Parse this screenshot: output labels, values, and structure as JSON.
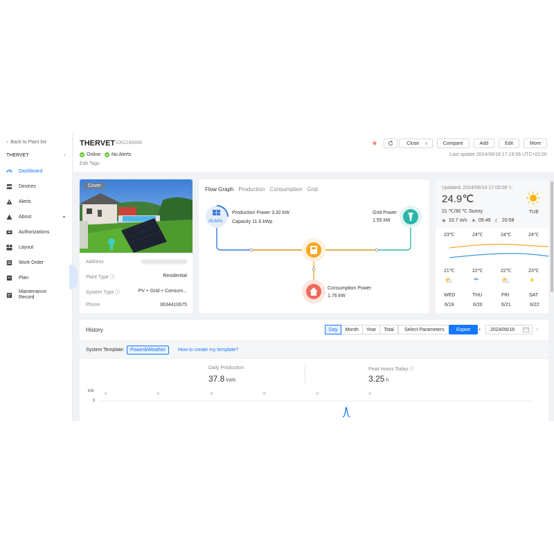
{
  "sidebar": {
    "back_label": "Back to Plant list",
    "plant_name": "THERVET",
    "items": [
      {
        "label": "Dashboard",
        "active": true
      },
      {
        "label": "Devices"
      },
      {
        "label": "Alerts"
      },
      {
        "label": "About"
      },
      {
        "label": "Authorizations"
      },
      {
        "label": "Layout"
      },
      {
        "label": "Work Order"
      },
      {
        "label": "Plan"
      },
      {
        "label": "Maintenance Record"
      }
    ]
  },
  "header": {
    "title": "THERVET",
    "plant_id": "ID62188888",
    "status_online": "Online",
    "status_alerts": "No Alerts",
    "edit_tags": "Edit Tags",
    "close_label": "Close",
    "compare_label": "Compare",
    "add_label": "Add",
    "edit_label": "Edit",
    "more_label": "More",
    "last_update": "Last update 2024/06/18 17:19:56 UTC+02:00"
  },
  "plant_info": {
    "cover_label": "Cover",
    "rows": [
      {
        "key": "Address",
        "value": ""
      },
      {
        "key": "Plant Type",
        "value": "Residential"
      },
      {
        "key": "System Type",
        "value": "PV + Grid + Consum..."
      },
      {
        "key": "Phone",
        "value": "0634410675"
      }
    ]
  },
  "flow": {
    "tabs": [
      "Flow Graph",
      "Production",
      "Consumption",
      "Grid"
    ],
    "pv_percent": "28.64%",
    "production_power": "Production Power 3.32 kW",
    "capacity": "Capacity 11.6 kWp",
    "grid_power_label": "Grid Power",
    "grid_power_value": "1.55 kW",
    "consumption_label": "Consumption Power",
    "consumption_value": "1.76 kW",
    "colors": {
      "pv": "#3a7bd5",
      "grid": "#2bb5a8",
      "inverter": "#f5a623",
      "load": "#f06a5a"
    }
  },
  "weather": {
    "updated": "Updated: 2024/06/18 17:00:00",
    "temp": "24.9℃",
    "day": "TUE",
    "range": "21 ℃/30 ℃ Sunny",
    "wind": "10.7 m/s",
    "sunrise": "05:49",
    "sunset": "20:58",
    "highs": [
      "23℃",
      "24℃",
      "24℃",
      "24℃"
    ],
    "lows": [
      "21℃",
      "22℃",
      "22℃",
      "23℃"
    ],
    "forecast": [
      {
        "day": "WED",
        "date": "6/19",
        "icon": "partly-cloudy-icon"
      },
      {
        "day": "THU",
        "date": "6/20",
        "icon": "rain-icon"
      },
      {
        "day": "FRI",
        "date": "6/21",
        "icon": "partly-cloudy-icon"
      },
      {
        "day": "SAT",
        "date": "6/22",
        "icon": "sun-icon"
      }
    ]
  },
  "history": {
    "title": "History",
    "periods": [
      "Day",
      "Month",
      "Year",
      "Total"
    ],
    "active_period": "Day",
    "select_params": "Select Parameters",
    "export": "Export",
    "date": "2024/06/18",
    "template_label": "System Template:",
    "template_value": "Power&Weather",
    "template_link": "How to create my template?",
    "daily_production_label": "Daily Production",
    "daily_production_value": "37.8",
    "daily_production_unit": "kWh",
    "peak_hours_label": "Peak Hours Today",
    "peak_hours_value": "3.25",
    "peak_hours_unit": "h",
    "axis_unit": "kW",
    "axis_tick": "9"
  }
}
